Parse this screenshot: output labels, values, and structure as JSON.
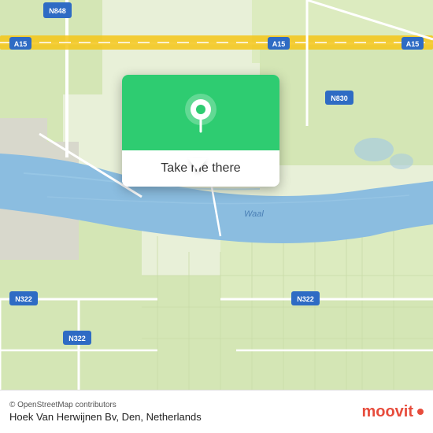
{
  "map": {
    "background_color": "#e8f0d8",
    "water_color": "#a8c8e8",
    "road_color": "#ffffff",
    "highway_color": "#f5c842",
    "highway_label_bg": "#3a6bc4"
  },
  "popup": {
    "button_label": "Take me there",
    "pin_color": "#2ecc71",
    "background_color": "#2ecc71"
  },
  "bottom_bar": {
    "osm_credit": "© OpenStreetMap contributors",
    "location_name": "Hoek Van Herwijnen Bv, Den, Netherlands",
    "moovit_label": "moovit"
  },
  "road_labels": {
    "n848": "N848",
    "a15_top_left": "A15",
    "a15_top_right": "A15",
    "a15_top_far": "A15",
    "n830": "N830",
    "waal": "Waal",
    "n322_left": "N322",
    "n322_bottom": "N322",
    "n322_right": "N322"
  }
}
